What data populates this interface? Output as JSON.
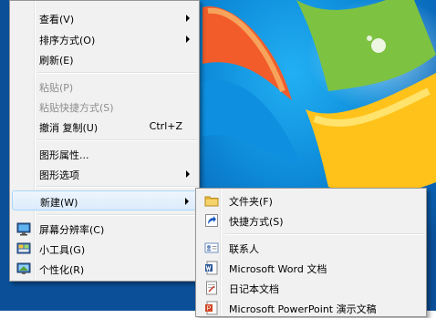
{
  "menu": {
    "items": [
      {
        "label": "查看(V)",
        "arrow": true
      },
      {
        "label": "排序方式(O)",
        "arrow": true
      },
      {
        "label": "刷新(E)"
      },
      {
        "label": "粘贴(P)",
        "disabled": true
      },
      {
        "label": "粘贴快捷方式(S)",
        "disabled": true
      },
      {
        "label": "撤消 复制(U)",
        "shortcut": "Ctrl+Z"
      },
      {
        "label": "图形属性..."
      },
      {
        "label": "图形选项",
        "arrow": true
      },
      {
        "label": "新建(W)",
        "arrow": true,
        "highlighted": true
      },
      {
        "label": "屏幕分辨率(C)",
        "icon": "monitor-icon"
      },
      {
        "label": "小工具(G)",
        "icon": "gadgets-icon"
      },
      {
        "label": "个性化(R)",
        "icon": "personalize-icon"
      }
    ]
  },
  "submenu": {
    "items": [
      {
        "label": "文件夹(F)",
        "icon": "folder-icon"
      },
      {
        "label": "快捷方式(S)",
        "icon": "shortcut-icon"
      },
      {
        "label": "联系人",
        "icon": "contact-icon"
      },
      {
        "label": "Microsoft Word 文档",
        "icon": "word-icon"
      },
      {
        "label": "日记本文档",
        "icon": "journal-icon"
      },
      {
        "label": "Microsoft PowerPoint 演示文稿",
        "icon": "powerpoint-icon"
      }
    ]
  },
  "colors": {
    "desktop_blue": "#0d8ad8",
    "menu_bg": "#f1f1f1",
    "highlight_border": "#a8d8fb",
    "disabled_text": "#8d8d8d"
  }
}
